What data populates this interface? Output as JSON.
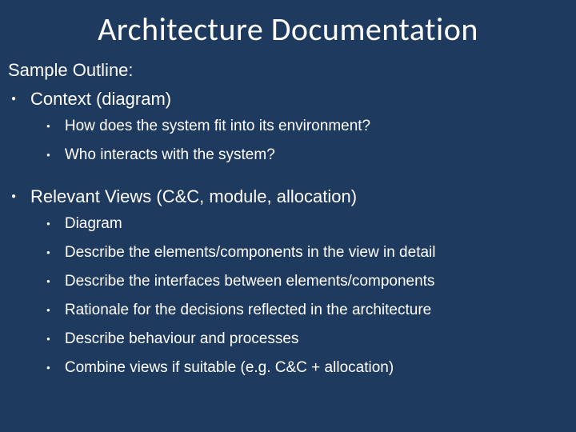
{
  "title": "Architecture Documentation",
  "subhead": "Sample Outline:",
  "items": [
    {
      "label": "Context (diagram)",
      "children": [
        "How does the system fit into its environment?",
        "Who interacts with the system?"
      ]
    },
    {
      "label": "Relevant Views (C&C, module, allocation)",
      "children": [
        "Diagram",
        "Describe the elements/components in the view in detail",
        "Describe the interfaces between elements/components",
        "Rationale for the decisions reflected in the architecture",
        "Describe behaviour and processes",
        "Combine views if suitable (e.g. C&C + allocation)"
      ]
    }
  ]
}
